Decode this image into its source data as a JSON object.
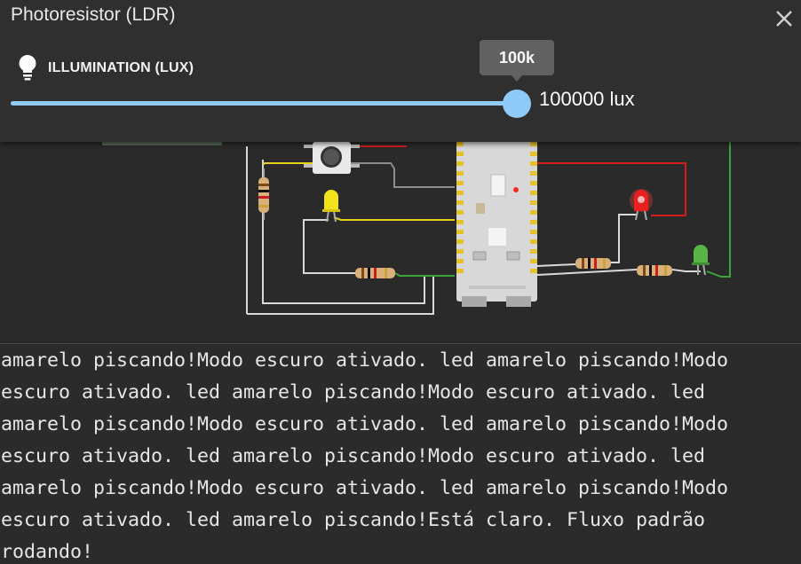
{
  "panel": {
    "title": "Photoresistor (LDR)",
    "close_icon": "close-icon",
    "illumination_label": "ILLUMINATION (LUX)",
    "bulb_icon": "lightbulb-icon",
    "slider_tooltip": "100k",
    "slider_fraction": 1.0,
    "value_text": "100000 lux"
  },
  "colors": {
    "slider": "#90caf9",
    "panel_bg": "#2f2f30",
    "canvas_bg": "#2a2a2a"
  },
  "serial": {
    "text": "amarelo piscando!Modo escuro ativado. led amarelo piscando!Modo escuro ativado. led amarelo piscando!Modo escuro ativado. led amarelo piscando!Modo escuro ativado. led amarelo piscando!Modo escuro ativado. led amarelo piscando!Modo escuro ativado. led amarelo piscando!Modo escuro ativado. led amarelo piscando!Modo escuro ativado. led amarelo piscando!Está claro. Fluxo padrão rodando!"
  }
}
